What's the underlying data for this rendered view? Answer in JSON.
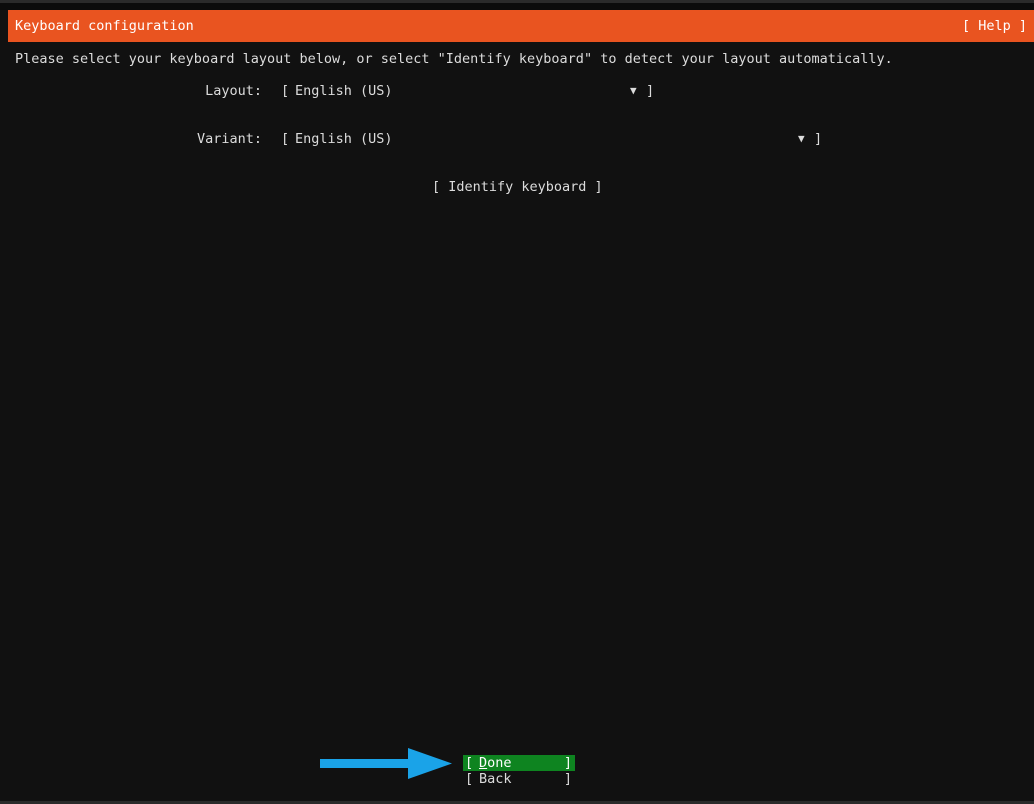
{
  "header": {
    "title": "Keyboard configuration",
    "help_label": "[ Help ]",
    "bg_color": "#e95420"
  },
  "instructions": "Please select your keyboard layout below, or select \"Identify keyboard\" to detect your layout automatically.",
  "layout": {
    "label": "Layout:",
    "value": "English (US)"
  },
  "variant": {
    "label": "Variant:",
    "value": "English (US)"
  },
  "identify_label": "[ Identify keyboard ]",
  "buttons": {
    "done": {
      "label": "Done",
      "color": "#0e8420"
    },
    "back": {
      "label": "Back"
    }
  },
  "annotation_arrow_color": "#1aa3e8"
}
